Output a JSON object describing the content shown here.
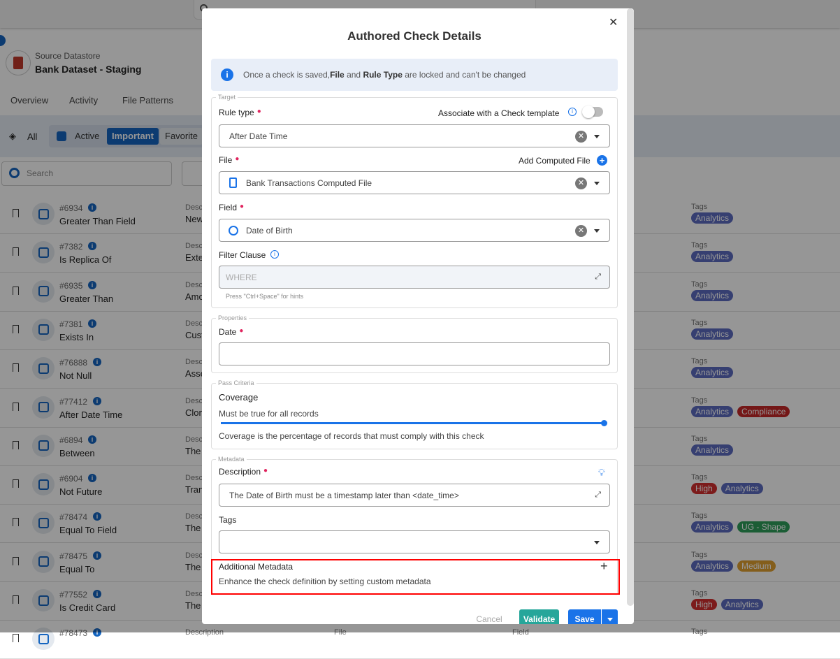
{
  "header": {
    "source_label": "Source Datastore",
    "datastore_name": "Bank Dataset - Staging"
  },
  "tabs": [
    "Overview",
    "Activity",
    "File Patterns"
  ],
  "filters": {
    "all": "All",
    "active": "Active",
    "important": "Important",
    "favorite": "Favorite"
  },
  "search": {
    "placeholder": "Search"
  },
  "list": {
    "description_label": "Description",
    "tags_label": "Tags",
    "file_label": "File",
    "field_label": "Field",
    "rows": [
      {
        "id": "#6934",
        "name": "Greater Than Field",
        "desc": "New",
        "tags": [
          {
            "t": "Analytics",
            "c": "#5c6bc0"
          }
        ]
      },
      {
        "id": "#7382",
        "name": "Is Replica Of",
        "desc": "Exte",
        "tags": [
          {
            "t": "Analytics",
            "c": "#5c6bc0"
          }
        ]
      },
      {
        "id": "#6935",
        "name": "Greater Than",
        "desc": "Amo",
        "tags": [
          {
            "t": "Analytics",
            "c": "#5c6bc0"
          }
        ]
      },
      {
        "id": "#7381",
        "name": "Exists In",
        "desc": "Cust",
        "tags": [
          {
            "t": "Analytics",
            "c": "#5c6bc0"
          }
        ]
      },
      {
        "id": "#76888",
        "name": "Not Null",
        "desc": "Asse",
        "tags": [
          {
            "t": "Analytics",
            "c": "#5c6bc0"
          }
        ]
      },
      {
        "id": "#77412",
        "name": "After Date Time",
        "desc": "Clon",
        "tags": [
          {
            "t": "Analytics",
            "c": "#5c6bc0"
          },
          {
            "t": "Compliance",
            "c": "#c62828"
          }
        ]
      },
      {
        "id": "#6894",
        "name": "Between",
        "desc": "The",
        "tags": [
          {
            "t": "Analytics",
            "c": "#5c6bc0"
          }
        ]
      },
      {
        "id": "#6904",
        "name": "Not Future",
        "desc": "Tran",
        "tags": [
          {
            "t": "High",
            "c": "#d32f2f"
          },
          {
            "t": "Analytics",
            "c": "#5c6bc0"
          }
        ]
      },
      {
        "id": "#78474",
        "name": "Equal To Field",
        "desc": "The",
        "tags": [
          {
            "t": "Analytics",
            "c": "#5c6bc0"
          },
          {
            "t": "UG - Shape",
            "c": "#2e9e5b"
          }
        ]
      },
      {
        "id": "#78475",
        "name": "Equal To",
        "desc": "The",
        "tags": [
          {
            "t": "Analytics",
            "c": "#5c6bc0"
          },
          {
            "t": "Medium",
            "c": "#e0a030"
          }
        ]
      },
      {
        "id": "#77552",
        "name": "Is Credit Card",
        "desc": "The",
        "tags": [
          {
            "t": "High",
            "c": "#d32f2f"
          },
          {
            "t": "Analytics",
            "c": "#5c6bc0"
          }
        ]
      },
      {
        "id": "#78473",
        "name": "",
        "desc": "",
        "tags": []
      }
    ]
  },
  "modal": {
    "title": "Authored Check Details",
    "alert": {
      "pre": "Once a check is saved, ",
      "file": "File",
      "and": " and ",
      "rule": "Rule Type",
      "post": " are locked and can't be changed"
    },
    "target": {
      "legend": "Target",
      "rule_type_label": "Rule type",
      "template_label": "Associate with a Check template",
      "template_enabled": false,
      "rule_type_value": "After Date Time",
      "file_label": "File",
      "add_computed": "Add Computed File",
      "file_value": "Bank Transactions Computed File",
      "field_label": "Field",
      "field_value": "Date of Birth",
      "filter_label": "Filter Clause",
      "filter_placeholder": "WHERE",
      "hint": "Press \"Ctrl+Space\" for hints"
    },
    "properties": {
      "legend": "Properties",
      "date_label": "Date",
      "date_value": ""
    },
    "pass": {
      "legend": "Pass Criteria",
      "coverage_label": "Coverage",
      "coverage_text": "Must be true for all records",
      "coverage_value": 100,
      "coverage_help": "Coverage is the percentage of records that must comply with this check"
    },
    "metadata": {
      "legend": "Metadata",
      "description_label": "Description",
      "description_value": "The Date of Birth must be a timestamp later than <date_time>",
      "tags_label": "Tags",
      "additional_title": "Additional Metadata",
      "additional_text": "Enhance the check definition by setting custom metadata"
    },
    "buttons": {
      "cancel": "Cancel",
      "validate": "Validate",
      "save": "Save"
    },
    "colors": {
      "primary": "#1a73e8",
      "validate": "#26a69a",
      "highlight": "#ff0000"
    }
  }
}
